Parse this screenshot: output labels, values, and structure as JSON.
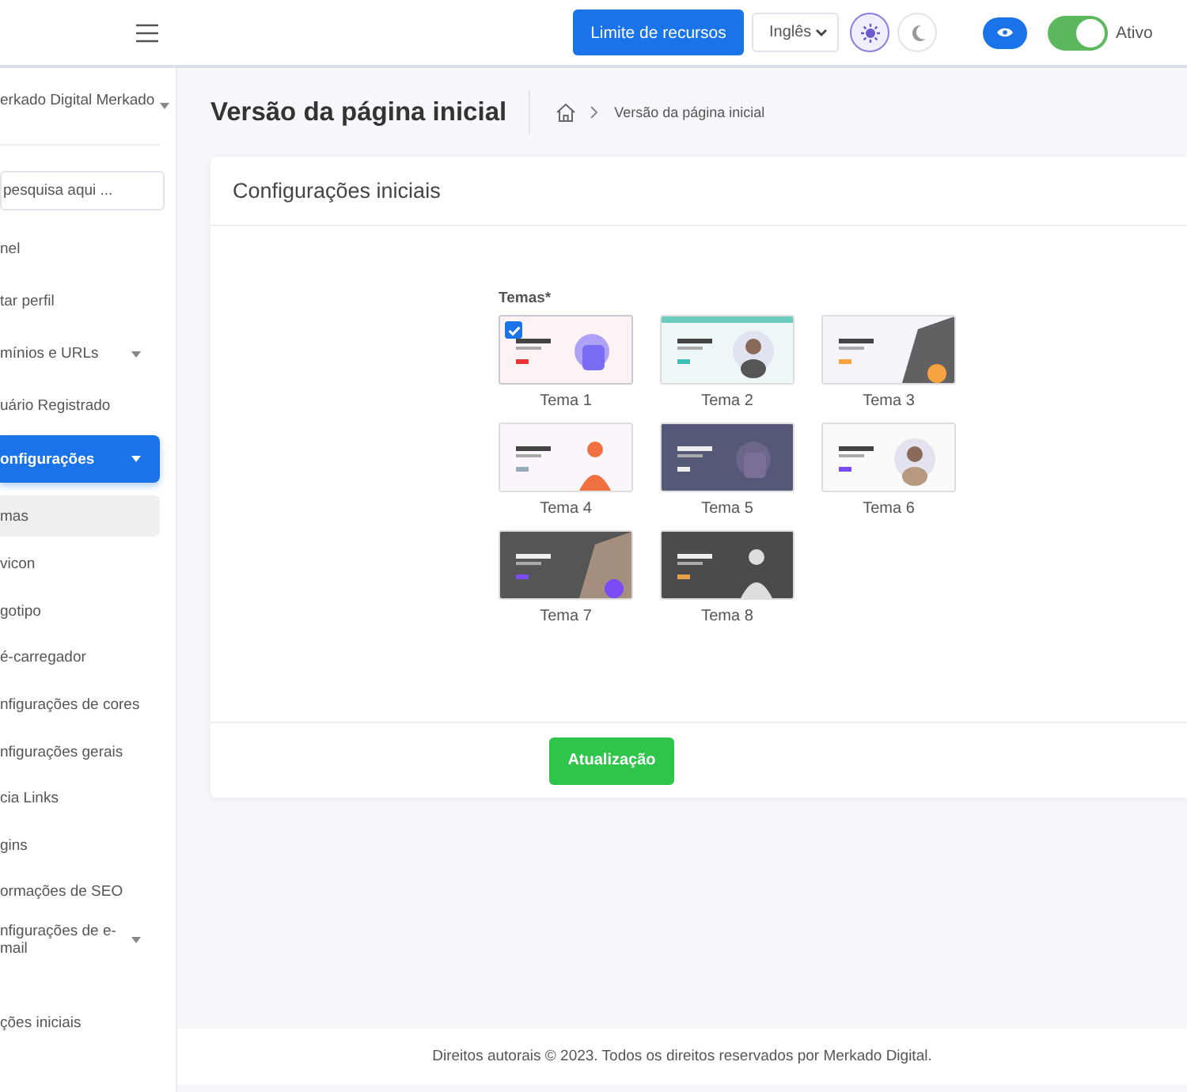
{
  "header": {
    "resource_button": "Limite de recursos",
    "language": "Inglês",
    "theme_buttons": [
      {
        "kind": "sun",
        "selected": true
      },
      {
        "kind": "moon",
        "selected": false
      }
    ],
    "status_toggle": {
      "on": true,
      "label": "Ativo"
    }
  },
  "sidebar": {
    "user": "erkado Digital Merkado",
    "search": {
      "placeholder": "pesquisa aqui ..."
    },
    "items": [
      {
        "kind": "link",
        "label": "nel",
        "selected": false
      },
      {
        "kind": "link",
        "label": "tar perfil",
        "selected": false
      },
      {
        "kind": "dropdown",
        "label": "mínios e URLs",
        "selected": false
      },
      {
        "kind": "link",
        "label": "uário Registrado",
        "selected": false
      },
      {
        "kind": "dropdown",
        "label": "onfigurações",
        "selected": true,
        "children": [
          {
            "kind": "link",
            "label": "mas",
            "selected": true
          },
          {
            "kind": "link",
            "label": "vicon",
            "selected": false
          },
          {
            "kind": "link",
            "label": "gotipo",
            "selected": false
          },
          {
            "kind": "link",
            "label": "é-carregador",
            "selected": false
          },
          {
            "kind": "link",
            "label": "nfigurações de cores",
            "selected": false
          },
          {
            "kind": "link",
            "label": "nfigurações gerais",
            "selected": false
          },
          {
            "kind": "link",
            "label": "cia Links",
            "selected": false
          },
          {
            "kind": "link",
            "label": "gins",
            "selected": false
          },
          {
            "kind": "link",
            "label": "ormações de SEO",
            "selected": false
          },
          {
            "kind": "dropdown",
            "label": "nfigurações de e-mail",
            "selected": false
          }
        ]
      },
      {
        "kind": "link",
        "label": "ções iniciais",
        "selected": false
      }
    ]
  },
  "page": {
    "title": "Versão da página inicial",
    "breadcrumb": [
      "Versão da página inicial"
    ]
  },
  "card": {
    "title": "Configurações iniciais",
    "themes_label": "Temas*",
    "themes": [
      {
        "label": "Tema 1",
        "selected": true
      },
      {
        "label": "Tema 2",
        "selected": false
      },
      {
        "label": "Tema 3",
        "selected": false
      },
      {
        "label": "Tema 4",
        "selected": false
      },
      {
        "label": "Tema 5",
        "selected": false
      },
      {
        "label": "Tema 6",
        "selected": false
      },
      {
        "label": "Tema 7",
        "selected": false
      },
      {
        "label": "Tema 8",
        "selected": false
      }
    ],
    "submit": "Atualização"
  },
  "footer": "Direitos autorais © 2023. Todos os direitos reservados por Merkado Digital."
}
